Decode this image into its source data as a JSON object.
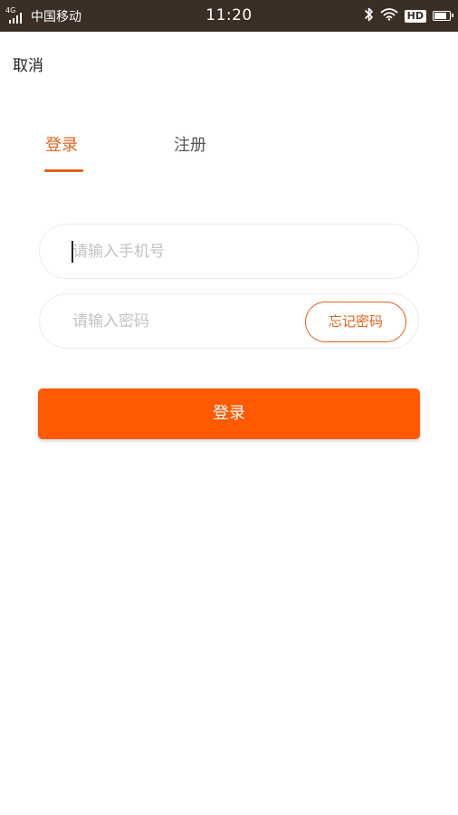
{
  "status_bar": {
    "network": "4G",
    "carrier": "中国移动",
    "time": "11:20",
    "hd_label": "HD",
    "icons": [
      "signal-icon",
      "bluetooth-icon",
      "wifi-icon",
      "battery-icon"
    ]
  },
  "header": {
    "cancel_label": "取消"
  },
  "tabs": [
    {
      "label": "登录",
      "active": true
    },
    {
      "label": "注册",
      "active": false
    }
  ],
  "form": {
    "phone": {
      "value": "",
      "placeholder": "请输入手机号"
    },
    "password": {
      "value": "",
      "placeholder": "请输入密码"
    },
    "forgot_label": "忘记密码",
    "submit_label": "登录"
  },
  "colors": {
    "accent": "#e2641f",
    "primary_button": "#ff5a00",
    "status_bar_bg": "#3a2e25",
    "placeholder": "#c2c2c2"
  }
}
